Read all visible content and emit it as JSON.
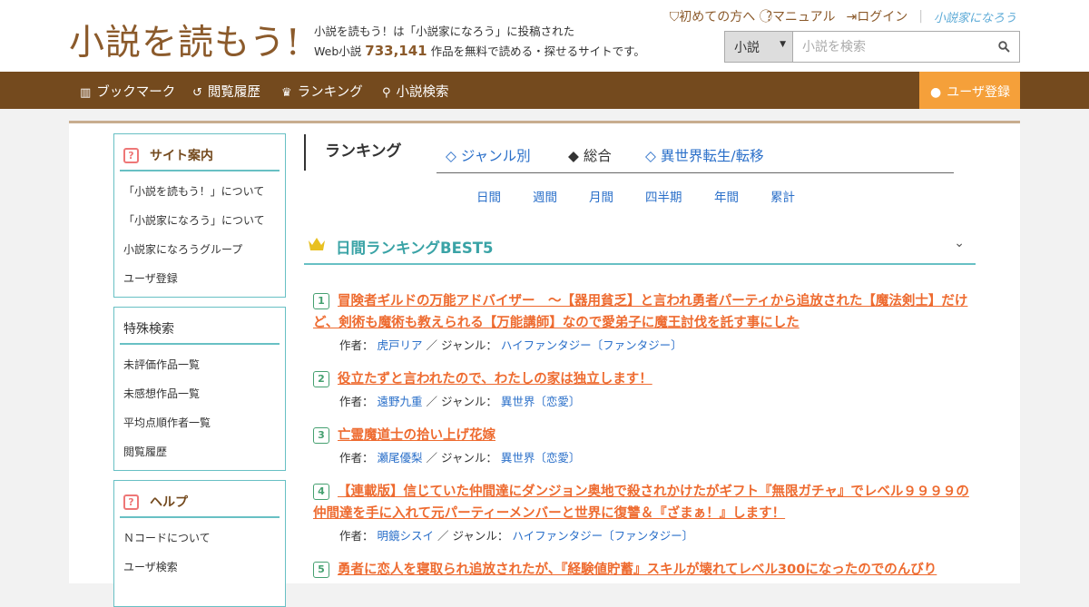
{
  "header": {
    "logo": "小説を読もう!",
    "desc_line1": "小説を読もう！は「小説家になろう」に投稿された",
    "desc_prefix": "Web小説",
    "count": "733,141",
    "desc_suffix": "作品を無料で読める・探せるサイトです。",
    "links": [
      "初めての方へ",
      "マニュアル",
      "ログイン"
    ],
    "narou_logo": "小説家になろう"
  },
  "search": {
    "select_value": "小説",
    "placeholder": "小説を検索"
  },
  "nav": {
    "items": [
      "ブックマーク",
      "閲覧履歴",
      "ランキング",
      "小説検索"
    ],
    "register": "ユーザ登録"
  },
  "sidebar": {
    "site_guide": {
      "title": "サイト案内",
      "items": [
        "「小説を読もう！」について",
        "「小説家になろう」について",
        "小説家になろうグループ",
        "ユーザ登録"
      ]
    },
    "special_search": {
      "title": "特殊検索",
      "items": [
        "未評価作品一覧",
        "未感想作品一覧",
        "平均点順作者一覧",
        "閲覧履歴"
      ]
    },
    "help": {
      "title": "ヘルプ",
      "items": [
        "Ｎコードについて",
        "ユーザ検索"
      ]
    }
  },
  "ranking": {
    "title": "ランキング",
    "tabs": [
      "◇ ジャンル別",
      "◆ 総合",
      "◇ 異世界転生/転移"
    ],
    "periods": [
      "日間",
      "週間",
      "月間",
      "四半期",
      "年間",
      "累計"
    ],
    "best_title": "日間ランキングBEST5",
    "author_label": "作者：",
    "genre_label": "／ ジャンル：",
    "entries": [
      {
        "rank": "1",
        "title": "冒険者ギルドの万能アドバイザー　～【器用貧乏】と言われ勇者パーティから追放された【魔法剣士】だけど、剣術も魔術も教えられる【万能講師】なので愛弟子に魔王討伐を託す事にした",
        "author": "虎戸リア",
        "genre": "ハイファンタジー〔ファンタジー〕"
      },
      {
        "rank": "2",
        "title": "役立たずと言われたので、わたしの家は独立します！",
        "author": "遠野九重",
        "genre": "異世界〔恋愛〕"
      },
      {
        "rank": "3",
        "title": "亡霊魔道士の拾い上げ花嫁",
        "author": "瀬尾優梨",
        "genre": "異世界〔恋愛〕"
      },
      {
        "rank": "4",
        "title": "【連載版】信じていた仲間達にダンジョン奥地で殺されかけたがギフト『無限ガチャ』でレベル９９９９の仲間達を手に入れて元パーティーメンバーと世界に復讐＆『ざまぁ！』します！",
        "author": "明鏡シスイ",
        "genre": "ハイファンタジー〔ファンタジー〕"
      },
      {
        "rank": "5",
        "title": "勇者に恋人を寝取られ追放されたが、『経験値貯蓄』スキルが壊れてレベル300になったのでのんびり",
        "author": "",
        "genre": ""
      }
    ]
  }
}
